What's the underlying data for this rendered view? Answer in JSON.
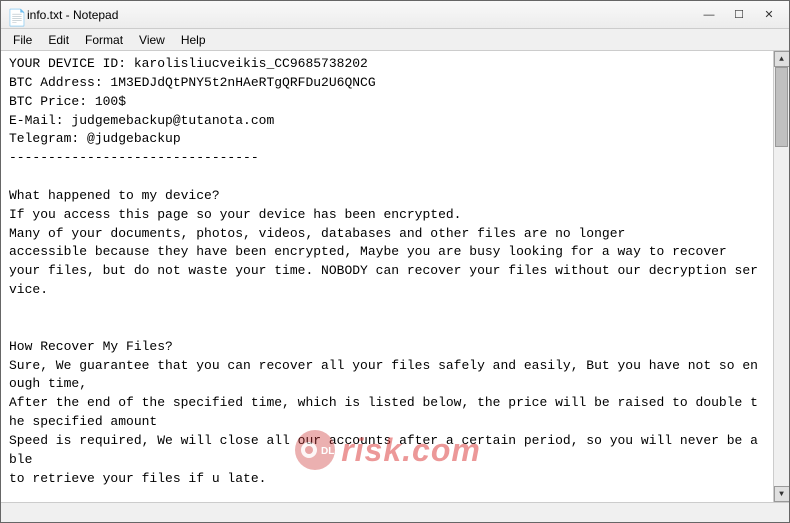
{
  "window": {
    "title": "info.txt - Notepad",
    "icon": "📄"
  },
  "menu": {
    "items": [
      "File",
      "Edit",
      "Format",
      "View",
      "Help"
    ]
  },
  "controls": {
    "minimize": "—",
    "maximize": "☐",
    "close": "✕"
  },
  "text_content": "YOUR DEVICE ID: karolisliucveikis_CC9685738202\nBTC Address: 1M3EDJdQtPNY5t2nHAeRTgQRFDu2U6QNCG\nBTC Price: 100$\nE-Mail: judgemebackup@tutanota.com\nTelegram: @judgebackup\n--------------------------------\n\nWhat happened to my device?\nIf you access this page so your device has been encrypted.\nMany of your documents, photos, videos, databases and other files are no longer\naccessible because they have been encrypted, Maybe you are busy looking for a way to recover\nyour files, but do not waste your time. NOBODY can recover your files without our decryption service.\n\n\nHow Recover My Files?\nSure, We guarantee that you can recover all your files safely and easily, But you have not so enough time,\nAfter the end of the specified time, which is listed below, the price will be raised to double the specified amount\nSpeed is required, We will close all our accounts after a certain period, so you will never be able\nto retrieve your files if u late.\n\n\nHow To Pay?\nOnly one payment is accepted (Bitcoin)\nPlease check the current price of Bitcoin and buy some bitcoins\nAnd send the correct amount to the address\n\n\nAfter payment",
  "watermark": {
    "text": "risk.com",
    "prefix": "dl"
  },
  "status_bar": {
    "text": ""
  }
}
